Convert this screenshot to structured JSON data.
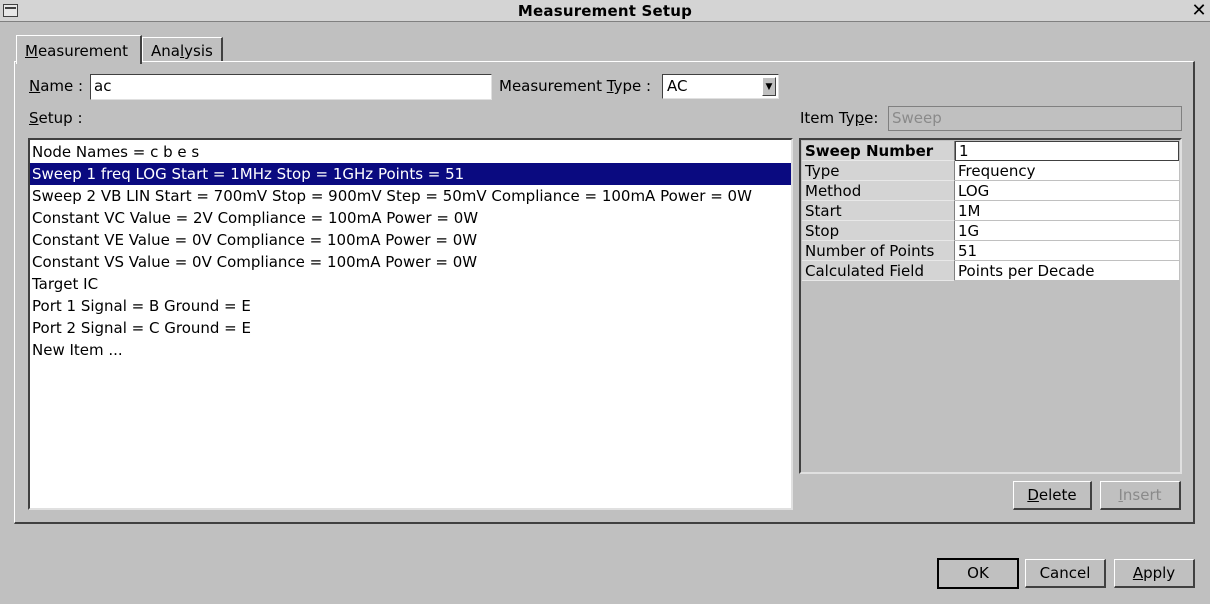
{
  "window": {
    "title": "Measurement Setup",
    "close_glyph": "✕"
  },
  "tabs": [
    {
      "pre": "",
      "key": "M",
      "post": "easurement"
    },
    {
      "pre": "Ana",
      "key": "l",
      "post": "ysis"
    }
  ],
  "form": {
    "name_label": {
      "pre": "",
      "key": "N",
      "post": "ame :"
    },
    "name_value": "ac",
    "type_label": {
      "pre": "Measurement ",
      "key": "T",
      "post": "ype :"
    },
    "type_value": "AC",
    "setup_label": {
      "pre": "",
      "key": "S",
      "post": "etup :"
    },
    "item_type_label": {
      "pre": "Item Ty",
      "key": "p",
      "post": "e:"
    },
    "item_type_value": "Sweep"
  },
  "setup_items": [
    "Node Names = c b e s",
    "Sweep 1 freq LOG Start = 1MHz Stop = 1GHz Points = 51",
    "Sweep 2 VB LIN Start = 700mV Stop = 900mV Step = 50mV Compliance = 100mA Power = 0W",
    "Constant VC Value = 2V Compliance = 100mA Power = 0W",
    "Constant VE Value = 0V Compliance = 100mA Power = 0W",
    "Constant VS Value = 0V Compliance = 100mA Power = 0W",
    "Target IC",
    "Port 1 Signal = B Ground = E",
    "Port 2 Signal = C Ground = E",
    "New Item ..."
  ],
  "properties": [
    {
      "key": "Sweep Number",
      "value": "1"
    },
    {
      "key": "Type",
      "value": "Frequency"
    },
    {
      "key": "Method",
      "value": "LOG"
    },
    {
      "key": "Start",
      "value": "1M"
    },
    {
      "key": "Stop",
      "value": "1G"
    },
    {
      "key": "Number of Points",
      "value": "51"
    },
    {
      "key": "Calculated Field",
      "value": "Points per Decade"
    }
  ],
  "buttons": {
    "delete": {
      "pre": "",
      "key": "D",
      "post": "elete"
    },
    "insert": {
      "pre": "",
      "key": "I",
      "post": "nsert"
    },
    "ok": "OK",
    "cancel": "Cancel",
    "apply": {
      "pre": "",
      "key": "A",
      "post": "pply"
    }
  }
}
